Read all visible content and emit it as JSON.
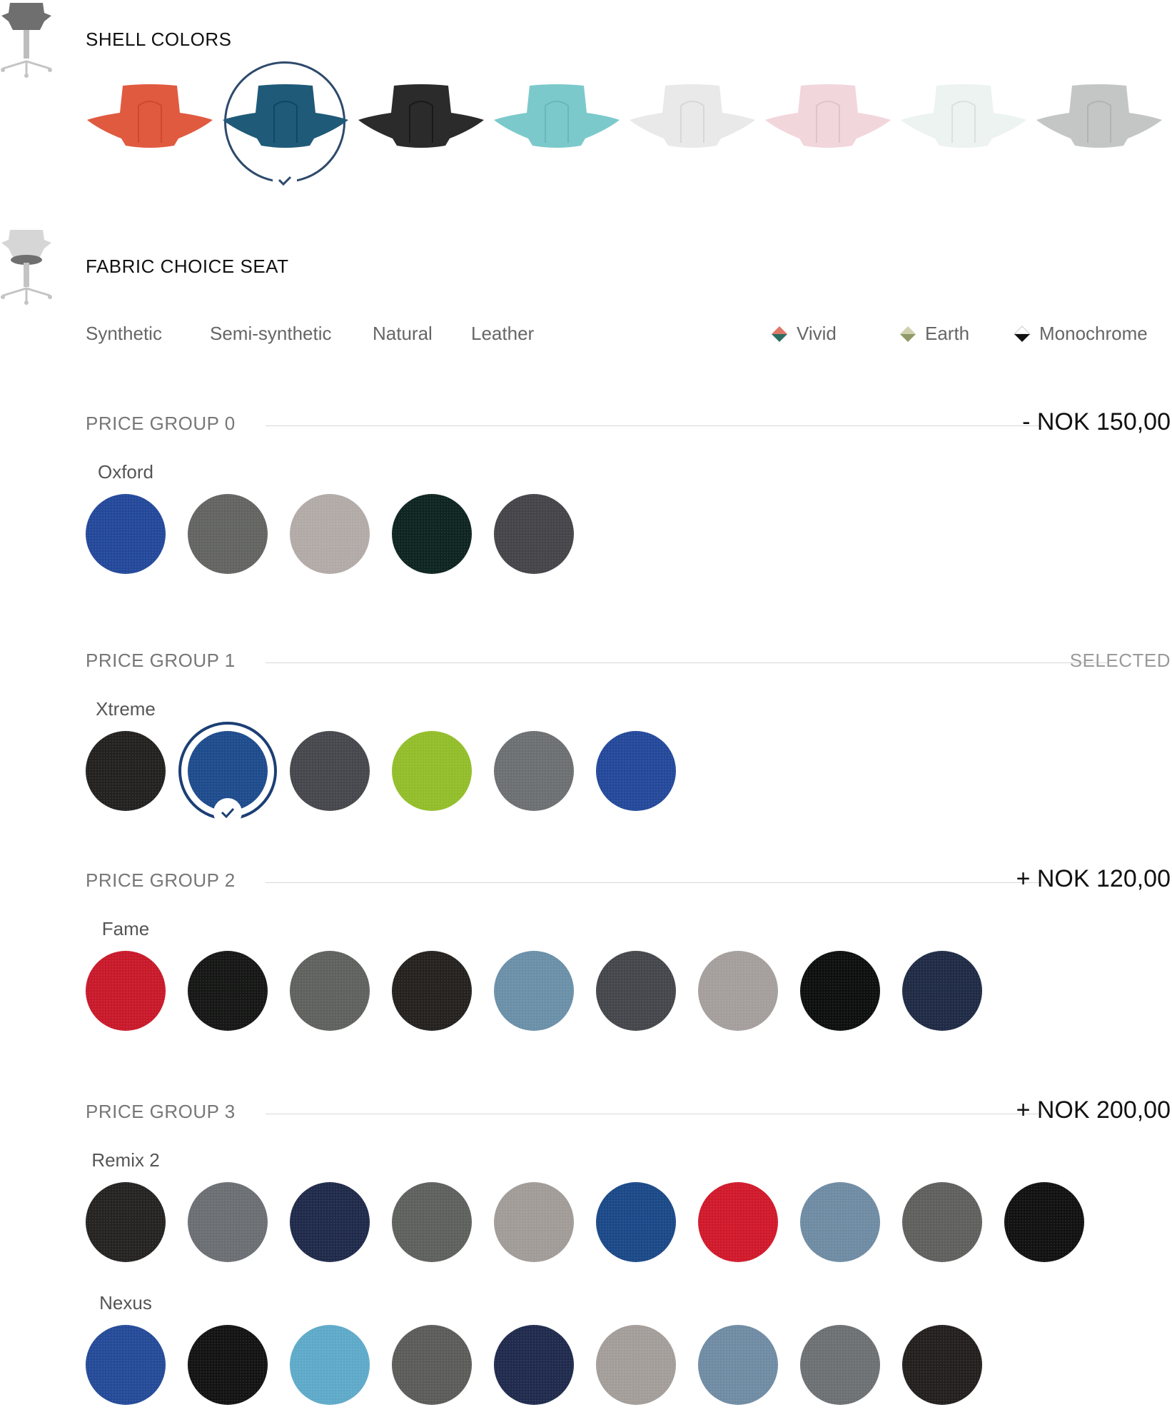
{
  "shell_section": {
    "title": "SHELL COLORS",
    "shells": [
      {
        "color": "#e05a40",
        "selected": false
      },
      {
        "color": "#1f5a78",
        "selected": true
      },
      {
        "color": "#2b2b2b",
        "selected": false
      },
      {
        "color": "#7cc9cb",
        "selected": false
      },
      {
        "color": "#e9e9e9",
        "selected": false
      },
      {
        "color": "#f1d6db",
        "selected": false
      },
      {
        "color": "#ecf3f0",
        "selected": false
      },
      {
        "color": "#c4c6c6",
        "selected": false
      }
    ]
  },
  "fabric_section": {
    "title": "FABRIC CHOICE SEAT",
    "types": [
      "Synthetic",
      "Semi-synthetic",
      "Natural",
      "Leather"
    ],
    "palettes": [
      {
        "label": "Vivid",
        "top": "#e07868",
        "bottom": "#2d6e63"
      },
      {
        "label": "Earth",
        "top": "#cfd1b0",
        "bottom": "#8f9a66"
      },
      {
        "label": "Monochrome",
        "top": "#ffffff",
        "bottom": "#111111"
      }
    ]
  },
  "groups": [
    {
      "label": "PRICE GROUP 0",
      "price": "- NOK 150,00",
      "status": "",
      "fabrics": [
        {
          "name": "Oxford",
          "swatches": [
            "#23489a",
            "#636461",
            "#b2aaa6",
            "#0d2420",
            "#444449"
          ]
        }
      ]
    },
    {
      "label": "PRICE GROUP 1",
      "price": "",
      "status": "SELECTED",
      "fabrics": [
        {
          "name": "Xtreme",
          "swatches": [
            "#232120",
            "#1d4b8c",
            "#46474c",
            "#92bd2a",
            "#6c6f72",
            "#24489a"
          ],
          "selected_index": 1
        }
      ]
    },
    {
      "label": "PRICE GROUP 2",
      "price": "+ NOK 120,00",
      "status": "",
      "fabrics": [
        {
          "name": "Fame",
          "swatches": [
            "#c8192a",
            "#151615",
            "#5f615e",
            "#24211f",
            "#6a8fa8",
            "#45464b",
            "#a49e9c",
            "#0d0e0e",
            "#1f2a45"
          ]
        }
      ]
    },
    {
      "label": "PRICE GROUP 3",
      "price": "+ NOK 200,00",
      "status": "",
      "fabrics": [
        {
          "name": "Remix 2",
          "swatches": [
            "#252322",
            "#6b6e72",
            "#1f2a4a",
            "#5e605d",
            "#a19b98",
            "#1b4887",
            "#d0192b",
            "#6e8ba3",
            "#5f605e",
            "#111111"
          ]
        },
        {
          "name": "Nexus",
          "swatches": [
            "#244a98",
            "#121212",
            "#5ea9c9",
            "#5b5c5a",
            "#1f2a4c",
            "#a39d9a",
            "#6f8ba3",
            "#6d7073",
            "#231f1e"
          ]
        }
      ]
    }
  ]
}
